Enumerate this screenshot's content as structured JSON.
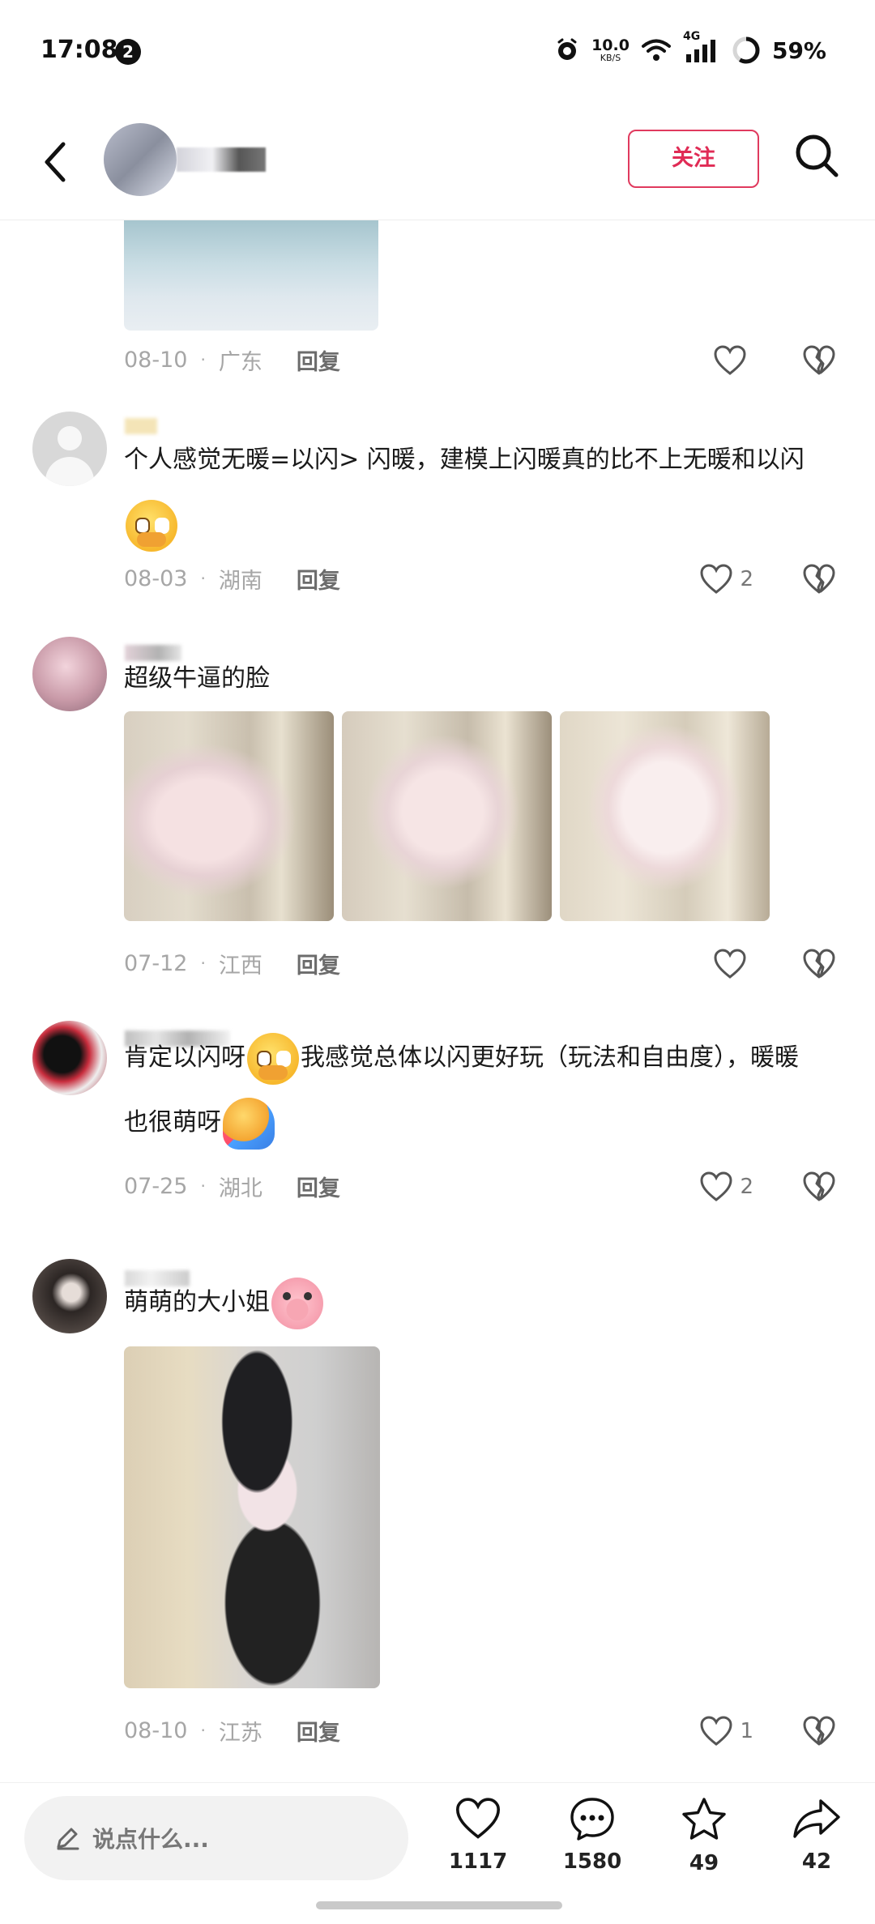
{
  "status_bar": {
    "time": "17:08",
    "notification_count": "2",
    "net_speed_value": "10.0",
    "net_speed_unit": "KB/S",
    "network_type": "4G",
    "battery": "59%"
  },
  "header": {
    "follow_label": "关注"
  },
  "comments": [
    {
      "date": "08-10",
      "location": "广东",
      "reply_label": "回复",
      "like_count": ""
    },
    {
      "text_part1": "个人感觉无暖=以闪> 闪暖，建模上闪暖真的比不上无暖和以闪",
      "date": "08-03",
      "location": "湖南",
      "reply_label": "回复",
      "like_count": "2"
    },
    {
      "text": "超级牛逼的脸",
      "date": "07-12",
      "location": "江西",
      "reply_label": "回复",
      "like_count": ""
    },
    {
      "text_part1": "肯定以闪呀",
      "text_part2": "我感觉总体以闪更好玩（玩法和自由度），暖暖",
      "text_part3": "也很萌呀",
      "date": "07-25",
      "location": "湖北",
      "reply_label": "回复",
      "like_count": "2"
    },
    {
      "text": "萌萌的大小姐",
      "date": "08-10",
      "location": "江苏",
      "reply_label": "回复",
      "like_count": "1"
    }
  ],
  "bottom_bar": {
    "input_placeholder": "说点什么...",
    "likes": "1117",
    "comments": "1580",
    "favorites": "49",
    "shares": "42"
  },
  "colors": {
    "accent": "#e02b55",
    "meta_gray": "#a6a6a6",
    "reply_gray": "#6c6c6c"
  }
}
